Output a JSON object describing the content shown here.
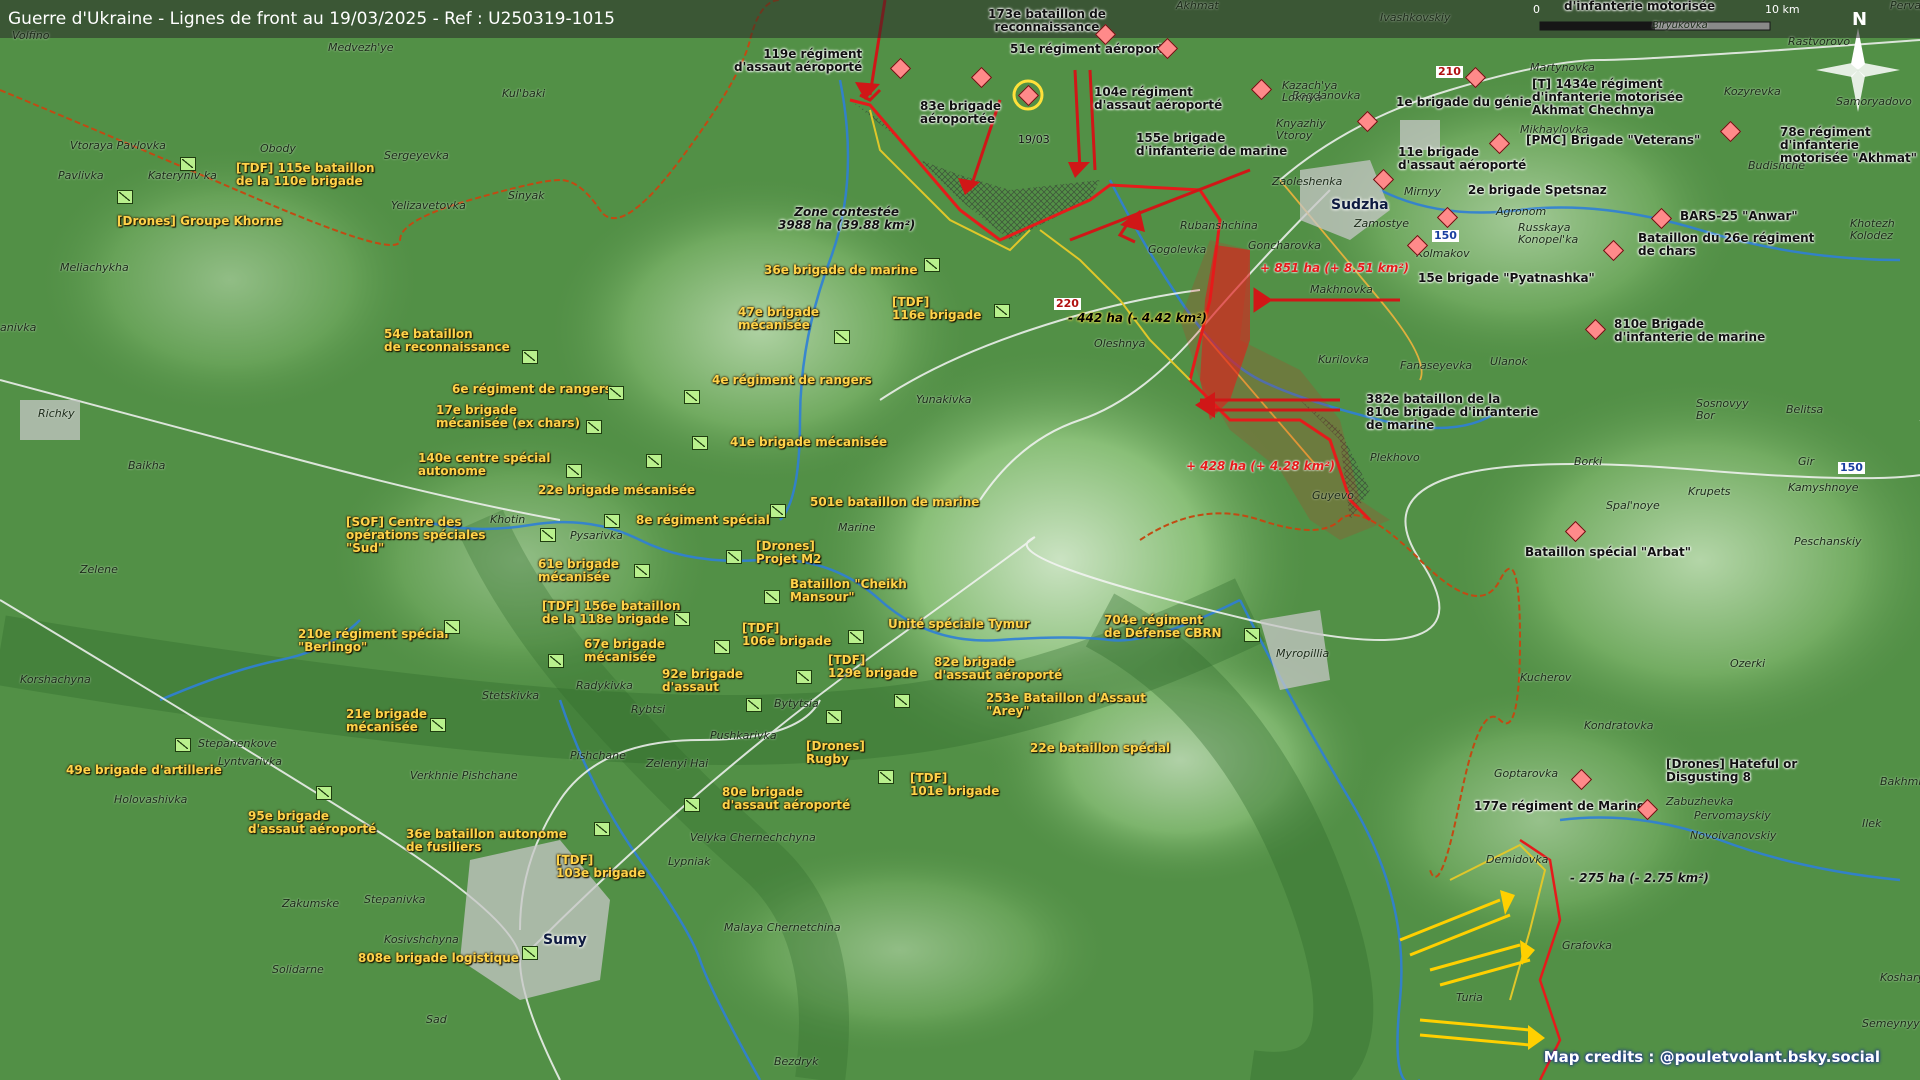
{
  "title": "Guerre d'Ukraine - Lignes de front au 19/03/2025 - Ref : U250319-1015",
  "scale": {
    "zero": "0",
    "ten": "10 km"
  },
  "north": "N",
  "credits": "Map credits : @pouletvolant.bsky.social",
  "colors": {
    "ukraine_unit": "#ffd34a",
    "russia_unit": "#e51b1b",
    "terrain": "#4f8a43",
    "front_line": "#e51b1b"
  },
  "cities": {
    "sumy": "Sumy",
    "sudzha": "Sudzha"
  },
  "towns": {
    "volfino": "Volfino",
    "medvezhye": "Medvezh'ye",
    "kulbaki": "Kul'baki",
    "obody": "Obody",
    "vtoraya_pavlovka": "Vtoraya Pavlovka",
    "pavlivka": "Pavlivka",
    "katerynivka": "Kateryniv ka",
    "sergeyevka": "Sergeyevka",
    "sinyak": "Sinyak",
    "yelizavetovka": "Yelizavetovka",
    "meliachykha": "Meliachykha",
    "anivka": "anivka",
    "richky": "Richky",
    "baikha": "Baikha",
    "khotin": "Khotin",
    "pysarivka": "Pysarivka",
    "marine": "Marine",
    "zelene": "Zelene",
    "korshachyna": "Korshachyna",
    "stetskivka": "Stetskivka",
    "radykivka": "Radykivka",
    "rybtsi": "Rybtsi",
    "bytytsia": "Bytytsia",
    "pushkarivka": "Pushkarivka",
    "stepanenkove": "Stepanenkove",
    "lyntvarivka": "Lyntvarivka",
    "holovashivka": "Holovashivka",
    "verkhnie": "Verkhnie Pishchane",
    "pishchane": "Pishchane",
    "zelenyi_hai": "Zelenyi Hai",
    "velyka": "Velyka Chernechchyna",
    "lypniak": "Lypniak",
    "malaya": "Malaya Chernetchina",
    "zakumske": "Zakumske",
    "stepanivka": "Stepanivka",
    "kosivshchyna": "Kosivshchyna",
    "solidarne": "Solidarne",
    "sad": "Sad",
    "bezdryk": "Bezdryk",
    "yunakivka": "Yunakivka",
    "olesh nya": "Oleshnya",
    "gogolevka": "Gogolevka",
    "rubanshchina": "Rubanshchina",
    "goncharovka": "Goncharovka",
    "makhnovka": "Makhnovka",
    "kurilovka": "Kurilovka",
    "guyevo": "Guyevo",
    "plekhovo": "Plekhovo",
    "fanaseyevka": "Fanaseyevka",
    "ulanok": "Ulanok",
    "zaoleshenka": "Zaoleshenka",
    "zamostye": "Zamostye",
    "mirnyy": "Mirnyy",
    "kolmakov": "Kolmakov",
    "agronom": "Agronom",
    "russkaya": "Russkaya Konopel'ka",
    "bogdanovka": "Bogdanovka",
    "kazachya": "Kazach'ya Loknya",
    "knyazhiy": "Knyazhiy Vtoroy",
    "martynovka": "Martynovka",
    "mikhaylovka": "Mikhaylovka",
    "ivashkovskiy": "Ivashkovskiy",
    "akhmat": "Akhmat",
    "pervay": "Pervay",
    "rastvorovo": "Rastvorovo",
    "samoryadovo": "Samoryadovo",
    "kozyrevka": "Kozyrevka",
    "budishche": "Budishche",
    "khotezh": "Khotezh Kolodez",
    "sosnovyy": "Sosnovyy Bor",
    "belitsa": "Belitsa",
    "borki": "Borki",
    "gir": "Gir",
    "kamyshnoye": "Kamyshnoye",
    "krupets": "Krupets",
    "spalnoye": "Spal'noye",
    "peschanskiy": "Peschanskiy",
    "myropillia": "Myropillia",
    "kucherov": "Kucherov",
    "ozerki": "Ozerki",
    "kondratovka": "Kondratovka",
    "goptarovka": "Goptarovka",
    "zabuzhevka": "Zabuzhevka",
    "pervomayskiy": "Pervomayskiy",
    "novoivanovskiy": "Novoivanovskiy",
    "demidovka": "Demidovka",
    "grafovka": "Grafovka",
    "turia": "Turia",
    "ilek": "Ilek",
    "bakhmi": "Bakhmi",
    "koshary": "Koshary",
    "semeynyy": "Semeynyy",
    "birjukovka": "Biryukovka"
  },
  "roads": {
    "r210a": "210",
    "r150a": "150",
    "r220": "220",
    "r150b": "150"
  },
  "areas": {
    "contested": "Zone contestée\n3988 ha (39.88 km²)",
    "gain1": "+ 851 ha (+ 8.51 km²)",
    "loss1": "- 442 ha (- 4.42 km²)",
    "gain2": "+ 428 ha (+ 4.28 km²)",
    "loss2": "- 275 ha (- 2.75 km²)",
    "date": "19/03"
  },
  "ukraine_units": [
    {
      "id": "u115",
      "label": "[TDF] 115e bataillon\nde la 110e brigade"
    },
    {
      "id": "ukhorne",
      "label": "[Drones] Groupe Khorne"
    },
    {
      "id": "u36m",
      "label": "36e brigade de marine"
    },
    {
      "id": "u116",
      "label": "[TDF]\n116e brigade"
    },
    {
      "id": "u47",
      "label": "47e brigade\nmécanisée"
    },
    {
      "id": "u54",
      "label": "54e bataillon\nde reconnaissance"
    },
    {
      "id": "u6r",
      "label": "6e régiment de rangers"
    },
    {
      "id": "u4r",
      "label": "4e régiment de rangers"
    },
    {
      "id": "u17",
      "label": "17e brigade\nmécanisée (ex chars)"
    },
    {
      "id": "u41",
      "label": "41e brigade mécanisée"
    },
    {
      "id": "u140",
      "label": "140e centre spécial\nautonome"
    },
    {
      "id": "u22",
      "label": "22e brigade mécanisée"
    },
    {
      "id": "u501",
      "label": "501e bataillon de marine"
    },
    {
      "id": "usof",
      "label": "[SOF] Centre des\nopérations spéciales\n\"Sud\""
    },
    {
      "id": "u8",
      "label": "8e régiment spécial"
    },
    {
      "id": "um2",
      "label": "[Drones]\nProjet M2"
    },
    {
      "id": "u61",
      "label": "61e brigade\nmécanisée"
    },
    {
      "id": "ucheikh",
      "label": "Bataillon \"Cheikh\nMansour\""
    },
    {
      "id": "u156",
      "label": "[TDF] 156e bataillon\nde la 118e brigade"
    },
    {
      "id": "u106",
      "label": "[TDF]\n106e brigade"
    },
    {
      "id": "utymur",
      "label": "Unité spéciale Tymur"
    },
    {
      "id": "u210",
      "label": "210e régiment spécial\n\"Berlingo\""
    },
    {
      "id": "u67",
      "label": "67e brigade\nmécanisée"
    },
    {
      "id": "u129",
      "label": "[TDF]\n129e brigade"
    },
    {
      "id": "u82",
      "label": "82e brigade\nd'assaut aéroporté"
    },
    {
      "id": "u92",
      "label": "92e brigade\nd'assaut"
    },
    {
      "id": "u253",
      "label": "253e Bataillon d'Assaut\n\"Arey\""
    },
    {
      "id": "u21",
      "label": "21e brigade\nmécanisée"
    },
    {
      "id": "urugby",
      "label": "[Drones]\nRugby"
    },
    {
      "id": "u22b",
      "label": "22e bataillon spécial"
    },
    {
      "id": "u49",
      "label": "49e brigade d'artillerie"
    },
    {
      "id": "u101",
      "label": "[TDF]\n101e brigade"
    },
    {
      "id": "u80",
      "label": "80e brigade\nd'assaut aéroporté"
    },
    {
      "id": "u95",
      "label": "95e brigade\nd'assaut aéroporté"
    },
    {
      "id": "u36b",
      "label": "36e bataillon autonome\nde fusiliers"
    },
    {
      "id": "u103",
      "label": "[TDF]\n103e brigade"
    },
    {
      "id": "u808",
      "label": "808e brigade logistique"
    },
    {
      "id": "u704",
      "label": "704e régiment\nde Défense CBRN"
    }
  ],
  "russia_units": [
    {
      "id": "r119",
      "label": "119e régiment\nd'assaut aéroporté"
    },
    {
      "id": "r173",
      "label": "173e bataillon de\nreconnaissance"
    },
    {
      "id": "r51",
      "label": "51e régiment aéroporté"
    },
    {
      "id": "r83",
      "label": "83e brigade\naéroportée"
    },
    {
      "id": "r104",
      "label": "104e régiment\nd'assaut aéroporté"
    },
    {
      "id": "r155",
      "label": "155e brigade\nd'infanterie de marine"
    },
    {
      "id": "r1g",
      "label": "1e brigade du génie"
    },
    {
      "id": "r11",
      "label": "11e brigade\nd'assaut aéroporté"
    },
    {
      "id": "r2s",
      "label": "2e brigade Spetsnaz"
    },
    {
      "id": "r1434",
      "label": "[T] 1434e régiment\nd'infanterie motorisée\nAkhmat Chechnya"
    },
    {
      "id": "rvet",
      "label": "[PMC] Brigade \"Veterans\""
    },
    {
      "id": "r78",
      "label": "78e régiment\nd'infanterie\nmotorisée \"Akhmat\""
    },
    {
      "id": "rbars",
      "label": "BARS-25 \"Anwar\""
    },
    {
      "id": "r26",
      "label": "Bataillon du 26e régiment\nde chars"
    },
    {
      "id": "r15",
      "label": "15e brigade \"Pyatnashka\""
    },
    {
      "id": "r810",
      "label": "810e Brigade\nd'infanterie de marine"
    },
    {
      "id": "r382",
      "label": "382e bataillon de la\n810e brigade d'infanterie\nde marine"
    },
    {
      "id": "rarbat",
      "label": "Bataillon spécial \"Arbat\""
    },
    {
      "id": "rhate",
      "label": "[Drones] Hateful or\nDisgusting 8"
    },
    {
      "id": "r177",
      "label": "177e régiment de Marine"
    },
    {
      "id": "rtop",
      "label": "d'infanterie motorisée"
    }
  ]
}
